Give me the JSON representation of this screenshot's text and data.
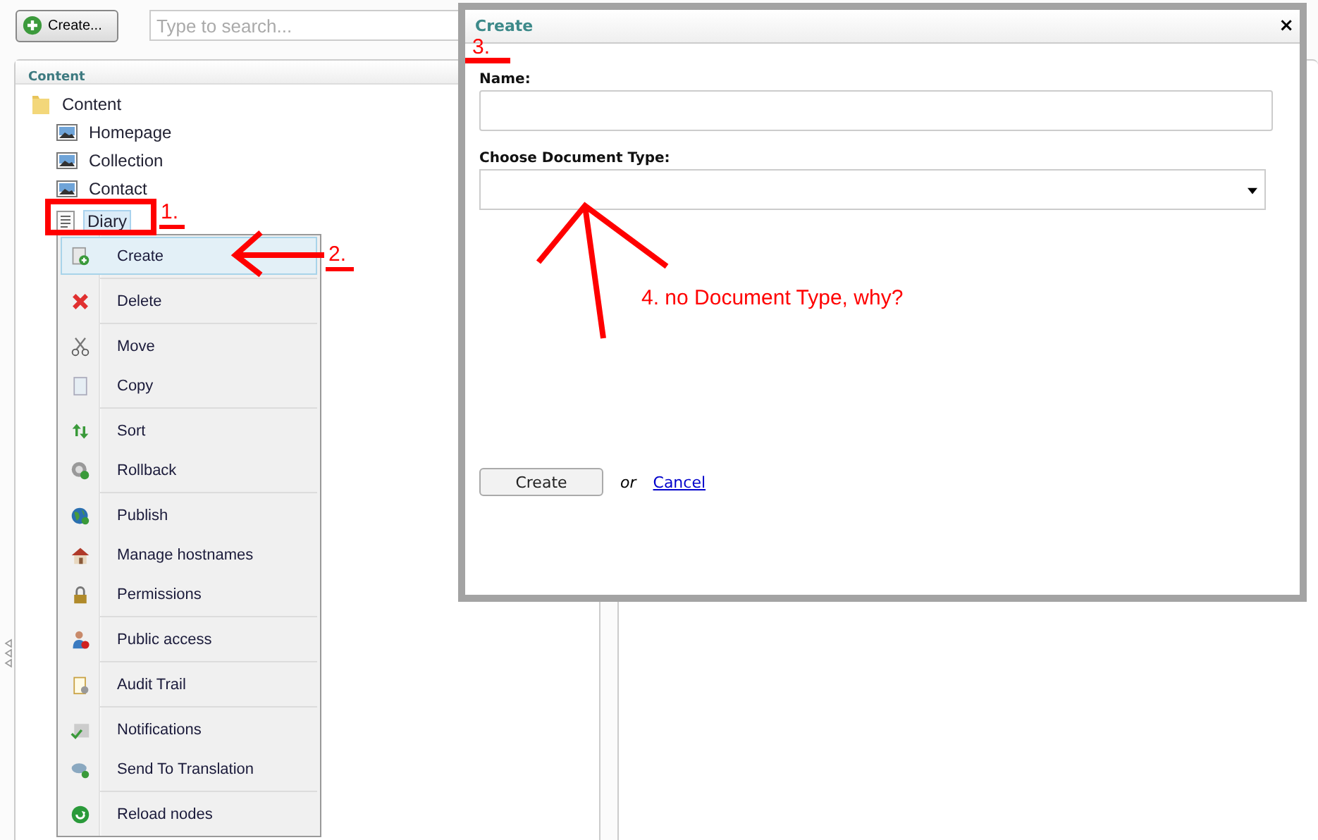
{
  "toolbar": {
    "create_button": "Create...",
    "search": {
      "placeholder": "Type to search..."
    }
  },
  "content_panel": {
    "title": "Content",
    "tree": [
      {
        "label": "Content",
        "kind": "folder",
        "selected": false,
        "children": [
          {
            "label": "Homepage",
            "kind": "page",
            "selected": false
          },
          {
            "label": "Collection",
            "kind": "page",
            "selected": false
          },
          {
            "label": "Contact",
            "kind": "page",
            "selected": false
          },
          {
            "label": "Diary",
            "kind": "document",
            "selected": true
          }
        ]
      }
    ]
  },
  "context_menu": {
    "groups": [
      [
        {
          "label": "Create",
          "selected": true
        }
      ],
      [
        {
          "label": "Delete",
          "selected": false
        }
      ],
      [
        {
          "label": "Move",
          "selected": false
        },
        {
          "label": "Copy",
          "selected": false
        }
      ],
      [
        {
          "label": "Sort",
          "selected": false
        },
        {
          "label": "Rollback",
          "selected": false
        }
      ],
      [
        {
          "label": "Publish",
          "selected": false
        },
        {
          "label": "Manage hostnames",
          "selected": false
        },
        {
          "label": "Permissions",
          "selected": false
        }
      ],
      [
        {
          "label": "Public access",
          "selected": false
        }
      ],
      [
        {
          "label": "Audit Trail",
          "selected": false
        }
      ],
      [
        {
          "label": "Notifications",
          "selected": false
        },
        {
          "label": "Send To Translation",
          "selected": false
        }
      ],
      [
        {
          "label": "Reload nodes",
          "selected": false
        }
      ]
    ]
  },
  "dialog": {
    "title": "Create",
    "close": "×",
    "fields": [
      {
        "label": "Name:",
        "kind": "text"
      },
      {
        "label": "Choose Document Type:",
        "kind": "select"
      }
    ],
    "submit": "Create",
    "or": "or",
    "cancel": "Cancel"
  },
  "annotations": [
    "1.",
    "2.",
    "3.",
    "4. no Document Type, why?"
  ]
}
